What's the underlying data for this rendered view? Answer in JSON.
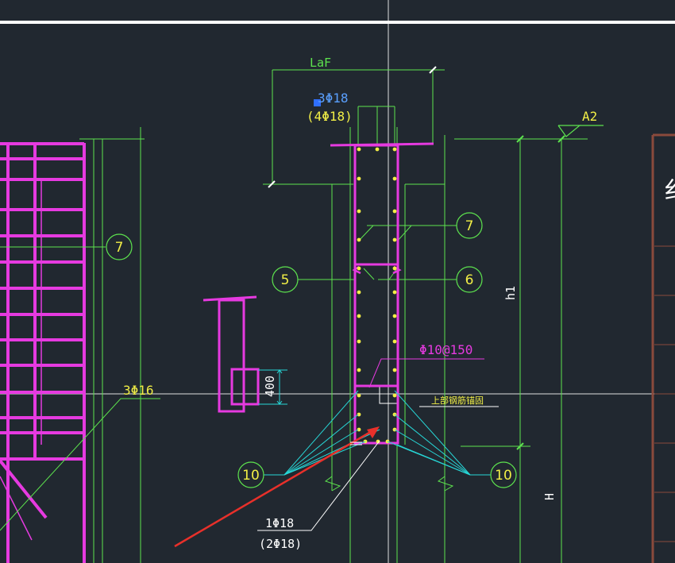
{
  "labels": {
    "laf": "LaF",
    "top_bars": "3Φ18",
    "top_bars_alt": "(4Φ18)",
    "axis_tag": "A2",
    "h1": "h1",
    "stirrup": "Φ10@150",
    "note": "上部钢筋锚固",
    "side_bars": "3Φ16",
    "dim_400": "400",
    "bottom_bars": "1Φ18",
    "bottom_bars_alt": "(2Φ18)",
    "H": "H"
  },
  "bubbles": {
    "b7_left": "7",
    "b7_right": "7",
    "b5": "5",
    "b6": "6",
    "b10_left": "10",
    "b10_right": "10"
  },
  "colors": {
    "background": "#212830",
    "rebar": "#e63ae0",
    "dimension": "#5de34e",
    "text": "#f2ef46",
    "leader": "#27d6d6",
    "arrow": "#e8302a",
    "frame": "#8a4a3c"
  }
}
